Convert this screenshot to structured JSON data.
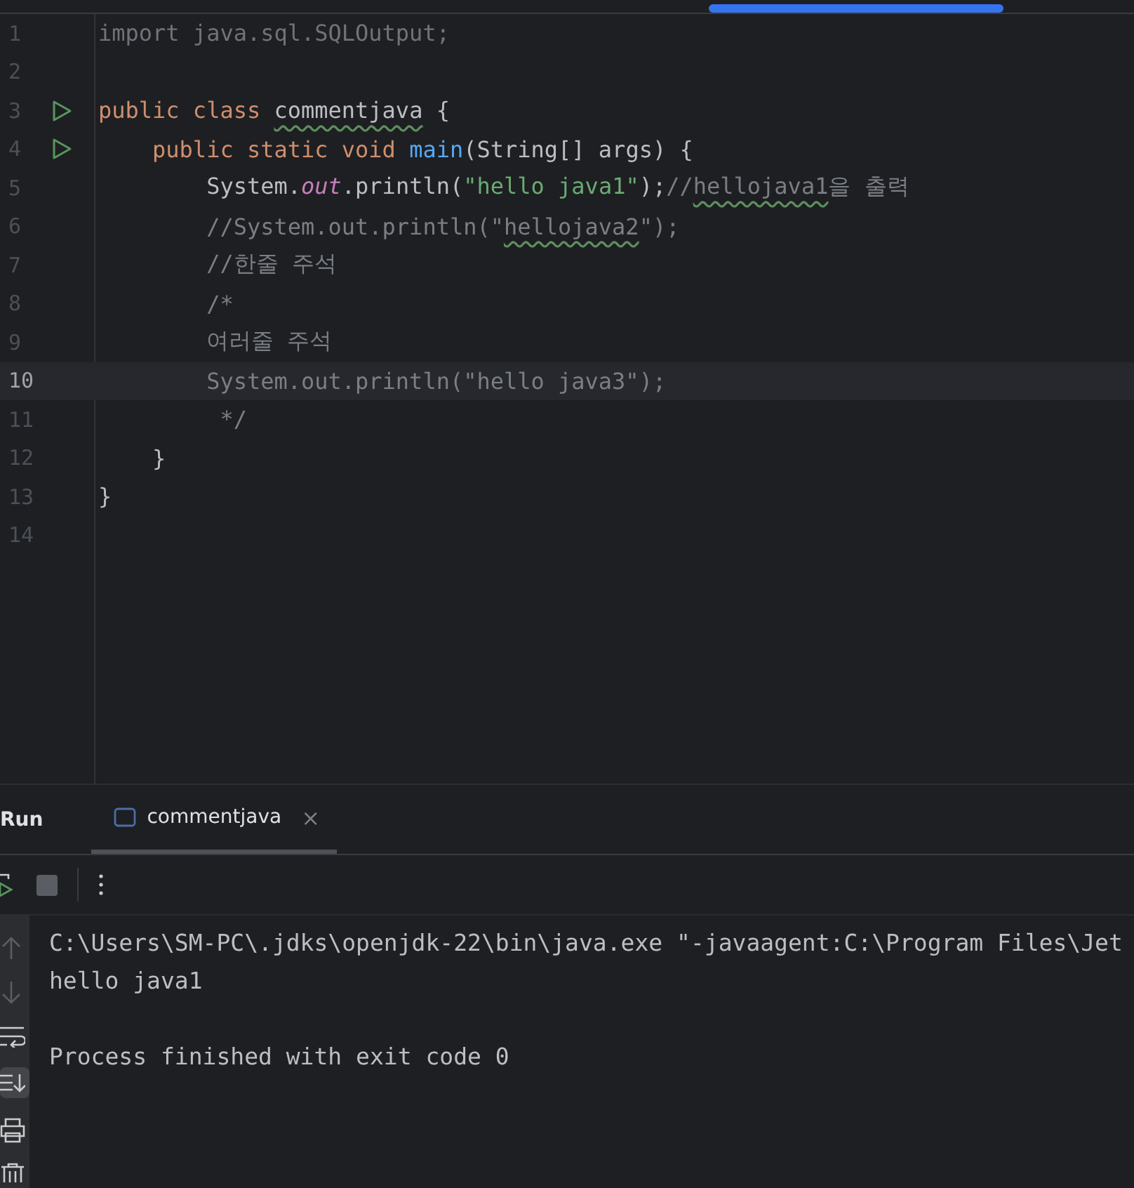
{
  "editor": {
    "lines": [
      {
        "number": "1",
        "run": false,
        "current": false,
        "tokens": [
          {
            "kind": "dim",
            "text": "import java.sql.SQLOutput;"
          }
        ]
      },
      {
        "number": "2",
        "run": false,
        "current": false
      },
      {
        "number": "3",
        "run": true,
        "current": false,
        "tokens": [
          {
            "kind": "kw",
            "text": "public class "
          },
          {
            "kind": "class-typo",
            "text": "commentjava"
          },
          {
            "kind": "id",
            "text": " {"
          }
        ]
      },
      {
        "number": "4",
        "run": true,
        "current": false,
        "tokens": [
          {
            "kind": "kw",
            "text": "    public static void "
          },
          {
            "kind": "fn",
            "text": "main"
          },
          {
            "kind": "id",
            "text": "(String[] args) {"
          }
        ]
      },
      {
        "number": "5",
        "run": false,
        "current": false,
        "tokens": [
          {
            "kind": "id",
            "text": "        System."
          },
          {
            "kind": "field",
            "text": "out"
          },
          {
            "kind": "id",
            "text": ".println("
          },
          {
            "kind": "str",
            "text": "\"hello java1\""
          },
          {
            "kind": "id",
            "text": ");"
          },
          {
            "kind": "cmt",
            "text": "//"
          },
          {
            "kind": "cmt-typo",
            "text": "hellojava1"
          },
          {
            "kind": "cmt",
            "text": "을 출력"
          }
        ]
      },
      {
        "number": "6",
        "run": false,
        "current": false,
        "tokens": [
          {
            "kind": "cmt",
            "text": "        //System.out.println(\""
          },
          {
            "kind": "cmt-typo",
            "text": "hellojava2"
          },
          {
            "kind": "cmt",
            "text": "\");"
          }
        ]
      },
      {
        "number": "7",
        "run": false,
        "current": false,
        "tokens": [
          {
            "kind": "cmt",
            "text": "        //한줄 주석"
          }
        ]
      },
      {
        "number": "8",
        "run": false,
        "current": false,
        "tokens": [
          {
            "kind": "cmt",
            "text": "        /*"
          }
        ]
      },
      {
        "number": "9",
        "run": false,
        "current": false,
        "tokens": [
          {
            "kind": "cmt",
            "text": "        여러줄 주석"
          }
        ]
      },
      {
        "number": "10",
        "run": false,
        "current": true,
        "tokens": [
          {
            "kind": "cmt",
            "text": "        System.out.println(\"hello java3\");"
          }
        ]
      },
      {
        "number": "11",
        "run": false,
        "current": false,
        "tokens": [
          {
            "kind": "cmt",
            "text": "         */"
          }
        ]
      },
      {
        "number": "12",
        "run": false,
        "current": false,
        "tokens": [
          {
            "kind": "id",
            "text": "    }"
          }
        ]
      },
      {
        "number": "13",
        "run": false,
        "current": false,
        "tokens": [
          {
            "kind": "id",
            "text": "}"
          }
        ]
      },
      {
        "number": "14",
        "run": false,
        "current": false
      }
    ]
  },
  "run_panel": {
    "title": "Run",
    "tabs": [
      {
        "label": "commentjava",
        "selected": true,
        "close": "×"
      }
    ],
    "console": [
      {
        "gap_before": false,
        "text": "C:\\Users\\SM-PC\\.jdks\\openjdk-22\\bin\\java.exe \"-javaagent:C:\\Program Files\\Jet"
      },
      {
        "gap_before": false,
        "text": "hello java1"
      },
      {
        "gap_before": true,
        "text": "Process finished with exit code 0"
      }
    ]
  }
}
